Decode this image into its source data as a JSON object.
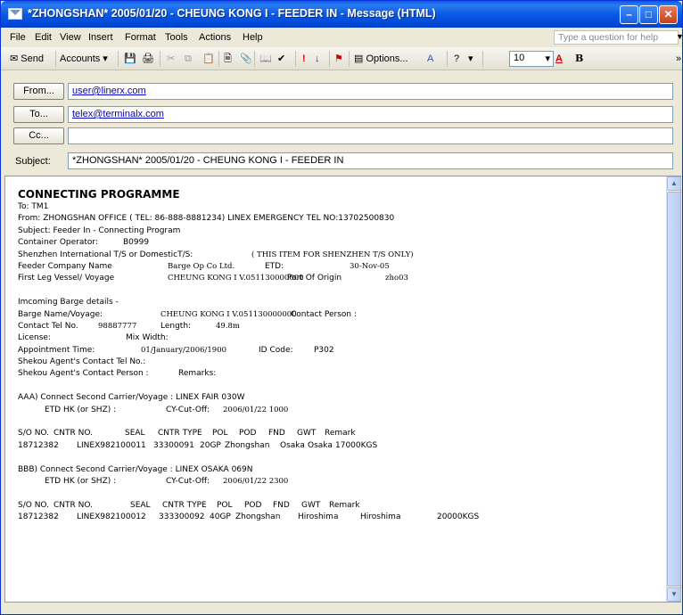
{
  "window": {
    "title": "*ZHONGSHAN* 2005/01/20 - CHEUNG KONG I - FEEDER IN - Message (HTML)"
  },
  "menu": [
    "File",
    "Edit",
    "View",
    "Insert",
    "Format",
    "Tools",
    "Actions",
    "Help"
  ],
  "help_placeholder": "Type a question for help",
  "toolbar": {
    "send": "Send",
    "accounts": "Accounts",
    "options": "Options...",
    "font_size": "10",
    "bold": "B"
  },
  "header": {
    "from_label": "From...",
    "from_value": "user@linerx.com",
    "to_label": "To...",
    "to_value": "telex@terminalx.com",
    "cc_label": "Cc...",
    "cc_value": "",
    "subject_label": "Subject:",
    "subject_value": "*ZHONGSHAN* 2005/01/20 - CHEUNG KONG I - FEEDER IN"
  },
  "message": {
    "heading": "CONNECTING PROGRAMME",
    "to": "To:   TM1",
    "from": "From:  ZHONGSHAN OFFICE ( TEL: 86-888-8881234)   LINEX EMERGENCY TEL NO:13702500830",
    "subject": "Subject: Feeder In - Connecting Program",
    "operator_label": "Container Operator:",
    "operator_value": "B0999",
    "shenzhen_label": "Shenzhen International T/S or DomesticT/S:",
    "shenzhen_note": "( THIS ITEM FOR SHENZHEN T/S ONLY)",
    "feeder_label": "Feeder Company Name",
    "feeder_value": "Barge Op Co Ltd.",
    "etd_label": "ETD:",
    "etd_value": "30-Nov-05",
    "first_leg_label": "First Leg Vessel/ Voyage",
    "first_leg_value": "CHEUNG KONG I  V.051130000000",
    "port_origin_label": "Port Of Origin",
    "port_origin_value": "zho03",
    "incoming": "Imcoming Barge details -",
    "barge_label": "Barge Name/Voyage:",
    "barge_value": "CHEUNG KONG I  V.051130000000",
    "contact_person_label": "Contact Person :",
    "contact_tel_label": "Contact Tel No.",
    "contact_tel_value": "98887777",
    "length_label": "Length:",
    "length_value": "49.8m",
    "license_label": "License:",
    "mix_width_label": "Mix Width:",
    "appt_label": "Appointment Time:",
    "appt_value": "01/January/2006/1900",
    "id_code_label": "ID Code:",
    "id_code_value": "P302",
    "shekou_tel_label": "Shekou Agent's Contact Tel No.:",
    "shekou_person_label": "Shekou Agent's Contact Person :",
    "remarks_label": "Remarks:",
    "aaa_title": "AAA)   Connect Second Carrier/Voyage : LINEX FAIR 030W",
    "aaa_etd_label": "ETD HK (or SHZ) :",
    "aaa_cutoff_label": "CY-Cut-Off:",
    "aaa_cutoff_value": "2006/01/22  1000",
    "bbb_title": "BBB)   Connect Second Carrier/Voyage : LINEX OSAKA 069N",
    "bbb_etd_label": "ETD HK (or SHZ) :",
    "bbb_cutoff_label": "CY-Cut-Off:",
    "bbb_cutoff_value": "2006/01/22  2300",
    "table_headers": [
      "S/O NO.",
      "CNTR NO.",
      "SEAL",
      "CNTR TYPE",
      "POL",
      "POD",
      "FND",
      "GWT",
      "Remark"
    ],
    "aaa_row": [
      "18712382",
      "LINEX982100011",
      "33300091",
      "20GP",
      "Zhongshan",
      "Osaka",
      "Osaka",
      "17000KGS"
    ],
    "bbb_row": [
      "18712382",
      "LINEX982100012",
      "333300092",
      "40GP",
      "Zhongshan",
      "Hiroshima",
      "Hiroshima",
      "20000KGS"
    ]
  }
}
